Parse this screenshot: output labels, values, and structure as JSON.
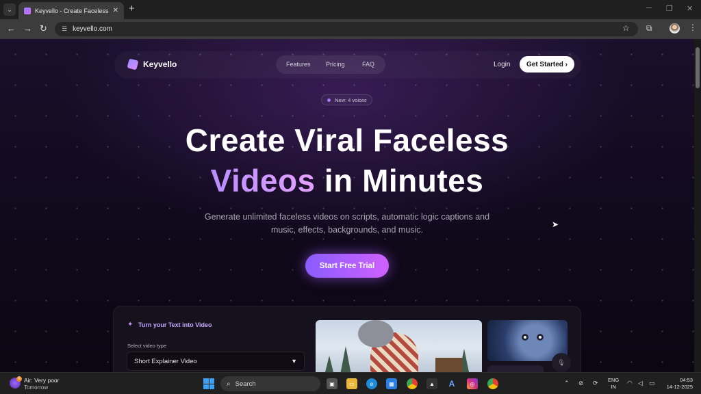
{
  "browser": {
    "tab_title": "Keyvello - Create Faceless Videos",
    "url": "keyvello.com",
    "new_tab_symbol": "+",
    "tab_close_symbol": "✕"
  },
  "nav": {
    "logo": "Keyvello",
    "links": [
      "Features",
      "Pricing",
      "FAQ"
    ],
    "login": "Login",
    "get_started": "Get Started ›"
  },
  "hero": {
    "badge": "New: 4 voices",
    "title_line1": "Create Viral Faceless",
    "title_line2_highlight": "Videos",
    "title_line2_rest": " in Minutes",
    "subtitle_line1": "Generate unlimited faceless videos on scripts, automatic logic captions and",
    "subtitle_line2": "music, effects, backgrounds, and music.",
    "cta": "Start Free Trial"
  },
  "demo": {
    "heading": "Turn your Text into Video",
    "select_label": "Select video type",
    "select_value": "Short Explainer Video"
  },
  "taskbar": {
    "weather_line1": "Air: Very poor",
    "weather_line2": "Tomorrow",
    "weather_badge": "6",
    "search_placeholder": "Search",
    "lang_line1": "ENG",
    "lang_line2": "IN",
    "time": "04:53",
    "date": "14-12-2025"
  }
}
